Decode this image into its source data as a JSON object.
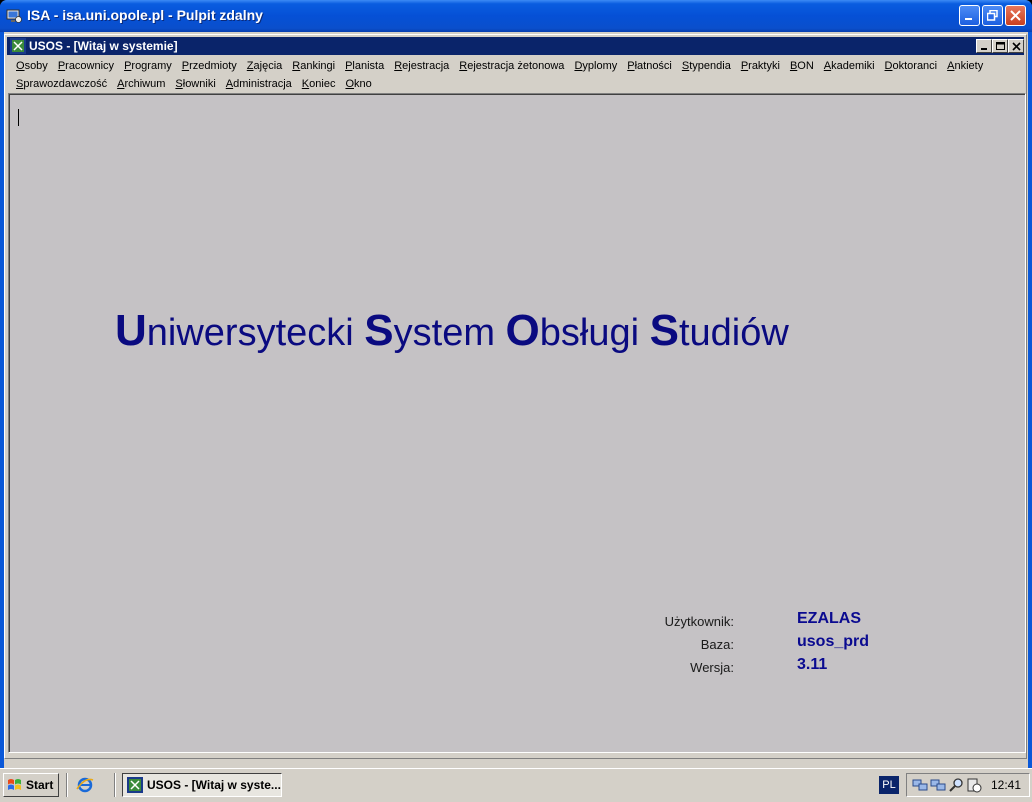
{
  "outer_window": {
    "title": "ISA - isa.uni.opole.pl - Pulpit zdalny"
  },
  "inner_window": {
    "title": "USOS - [Witaj w systemie]"
  },
  "menu": {
    "row1": [
      {
        "label": "Osoby",
        "u": "O"
      },
      {
        "label": "Pracownicy",
        "u": "P"
      },
      {
        "label": "Programy",
        "u": "P"
      },
      {
        "label": "Przedmioty",
        "u": "P"
      },
      {
        "label": "Zajęcia",
        "u": "Z"
      },
      {
        "label": "Rankingi",
        "u": "R"
      },
      {
        "label": "Planista",
        "u": "P"
      },
      {
        "label": "Rejestracja",
        "u": "R"
      },
      {
        "label": "Rejestracja żetonowa",
        "u": "R"
      },
      {
        "label": "Dyplomy",
        "u": "D"
      },
      {
        "label": "Płatności",
        "u": "P"
      },
      {
        "label": "Stypendia",
        "u": "S"
      },
      {
        "label": "Praktyki",
        "u": "P"
      },
      {
        "label": "BON",
        "u": "B"
      },
      {
        "label": "Akademiki",
        "u": "A"
      },
      {
        "label": "Doktoranci",
        "u": "D"
      },
      {
        "label": "Ankiety",
        "u": "A"
      }
    ],
    "row2": [
      {
        "label": "Sprawozdawczość",
        "u": "S"
      },
      {
        "label": "Archiwum",
        "u": "A"
      },
      {
        "label": "Słowniki",
        "u": "S"
      },
      {
        "label": "Administracja",
        "u": "A"
      },
      {
        "label": "Koniec",
        "u": "K"
      },
      {
        "label": "Okno",
        "u": "O"
      }
    ]
  },
  "headline": {
    "w1_cap": "U",
    "w1_rest": "niwersytecki ",
    "w2_cap": "S",
    "w2_rest": "ystem ",
    "w3_cap": "O",
    "w3_rest": "bsługi ",
    "w4_cap": "S",
    "w4_rest": "tudiów"
  },
  "info": {
    "user_label": "Użytkownik:",
    "user_value": "EZALAS",
    "db_label": "Baza:",
    "db_value": "usos_prd",
    "version_label": "Wersja:",
    "version_value": "3.11"
  },
  "taskbar": {
    "start_label": "Start",
    "task_label": "USOS - [Witaj w syste...",
    "lang": "PL",
    "clock": "12:41"
  },
  "icons": {
    "outer_app": "remote-desktop-icon",
    "inner_app": "usos-app-icon",
    "quicklaunch": "internet-explorer-icon",
    "start": "windows-flag-icon"
  },
  "colors": {
    "headline": "#0a0a80",
    "xp_title": "#0550d6",
    "inner_title": "#0a246a",
    "client_bg": "#c5c2c5"
  }
}
